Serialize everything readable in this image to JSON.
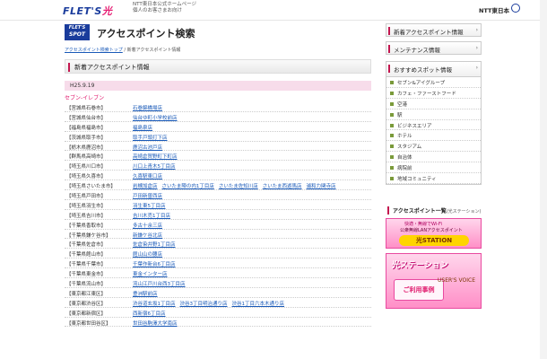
{
  "header": {
    "logo_main": "FLET'S",
    "logo_hikari": "光",
    "caption_line1": "NTT東日本公式ホームページ",
    "caption_line2": "個人のお客さまお向け",
    "corp_name": "NTT東日本"
  },
  "spot_logo": {
    "line1": "FLET'S",
    "line2": "SPOT"
  },
  "page_title": "アクセスポイント検索",
  "breadcrumb": {
    "link": "アクセスポイント検索トップ",
    "sep": "/",
    "current": "新着アクセスポイント情報"
  },
  "section_title": "新着アクセスポイント情報",
  "date": "H25.9.19",
  "chain": "セブン-イレブン",
  "rows": [
    {
      "area": "【宮城県石巻市】",
      "stores": [
        "石巻錦橋場店"
      ]
    },
    {
      "area": "【宮城県仙台市】",
      "stores": [
        "仙台ゆ町小学校前店"
      ]
    },
    {
      "area": "【福島県福島市】",
      "stores": [
        "福島泉店"
      ]
    },
    {
      "area": "【茨城県取手市】",
      "stores": [
        "取手戸頭打下店"
      ]
    },
    {
      "area": "【栃木県鹿沼市】",
      "stores": [
        "鹿沼古池戸店"
      ]
    },
    {
      "area": "【群馬県高崎市】",
      "stores": [
        "高崎倉賀野町下町店"
      ]
    },
    {
      "area": "【埼玉県川口市】",
      "stores": [
        "川口上青木5丁目店"
      ]
    },
    {
      "area": "【埼玉県久喜市】",
      "stores": [
        "久喜駅東口店"
      ]
    },
    {
      "area": "【埼玉県さいたま市】",
      "stores": [
        "岩槻加倉店",
        "さいたま陣の内1丁目店",
        "さいたま佐知川店",
        "さいたま西遊馬店",
        "浦和力関寺店"
      ]
    },
    {
      "area": "【埼玉県戸田市】",
      "stores": [
        "戸田新曽西店"
      ]
    },
    {
      "area": "【埼玉県羽生市】",
      "stores": [
        "羽生東5丁目店"
      ]
    },
    {
      "area": "【埼玉県吉川市】",
      "stores": [
        "吉川木売1丁目店"
      ]
    },
    {
      "area": "【千葉県香取市】",
      "stores": [
        "多古十余三店"
      ]
    },
    {
      "area": "【千葉県鎌ケ谷市】",
      "stores": [
        "新鎌ケ谷北店"
      ]
    },
    {
      "area": "【千葉県佐倉市】",
      "stores": [
        "佐倉染井野1丁目店"
      ]
    },
    {
      "area": "【千葉県館山市】",
      "stores": [
        "館山山の腰店"
      ]
    },
    {
      "area": "【千葉県千葉市】",
      "stores": [
        "千葉作新台6丁目店"
      ]
    },
    {
      "area": "【千葉県東金市】",
      "stores": [
        "東金インター店"
      ]
    },
    {
      "area": "【千葉県流山市】",
      "stores": [
        "流山江戸川台西3丁目店"
      ]
    },
    {
      "area": "【東京都江東区】",
      "stores": [
        "豊洲駅前店"
      ]
    },
    {
      "area": "【東京都渋谷区】",
      "stores": [
        "渋谷道玄坂1丁目店",
        "渋谷3丁目明治通り店",
        "渋谷1丁目六本木通り店"
      ]
    },
    {
      "area": "【東京都新宿区】",
      "stores": [
        "西新宿6丁目店"
      ]
    },
    {
      "area": "【東京都世田谷区】",
      "stores": [
        "世田谷駒澤大学南店"
      ]
    }
  ],
  "sidebar": {
    "new_info": "新着アクセスポイント情報",
    "maintenance": "メンテナンス情報",
    "recommend": "おすすめスポット情報",
    "spots": [
      "セブン&アイグループ",
      "カフェ・ファーストフード",
      "空港",
      "駅",
      "ビジネスエリア",
      "ホテル",
      "スタジアム",
      "自治体",
      "病院前",
      "地域コミュニティ"
    ],
    "ap_list_title": "アクセスポイント一覧",
    "ap_list_sub": "(光ステーション)",
    "banner1_top": "快適・無線でWi-Fi",
    "banner1_mid": "公衆無線LANアクセスポイント",
    "banner1_station": "光STATION",
    "banner2_station": "光ステーション",
    "banner2_case": "ご利用事例",
    "banner2_voice": "USER'S VOICE"
  }
}
